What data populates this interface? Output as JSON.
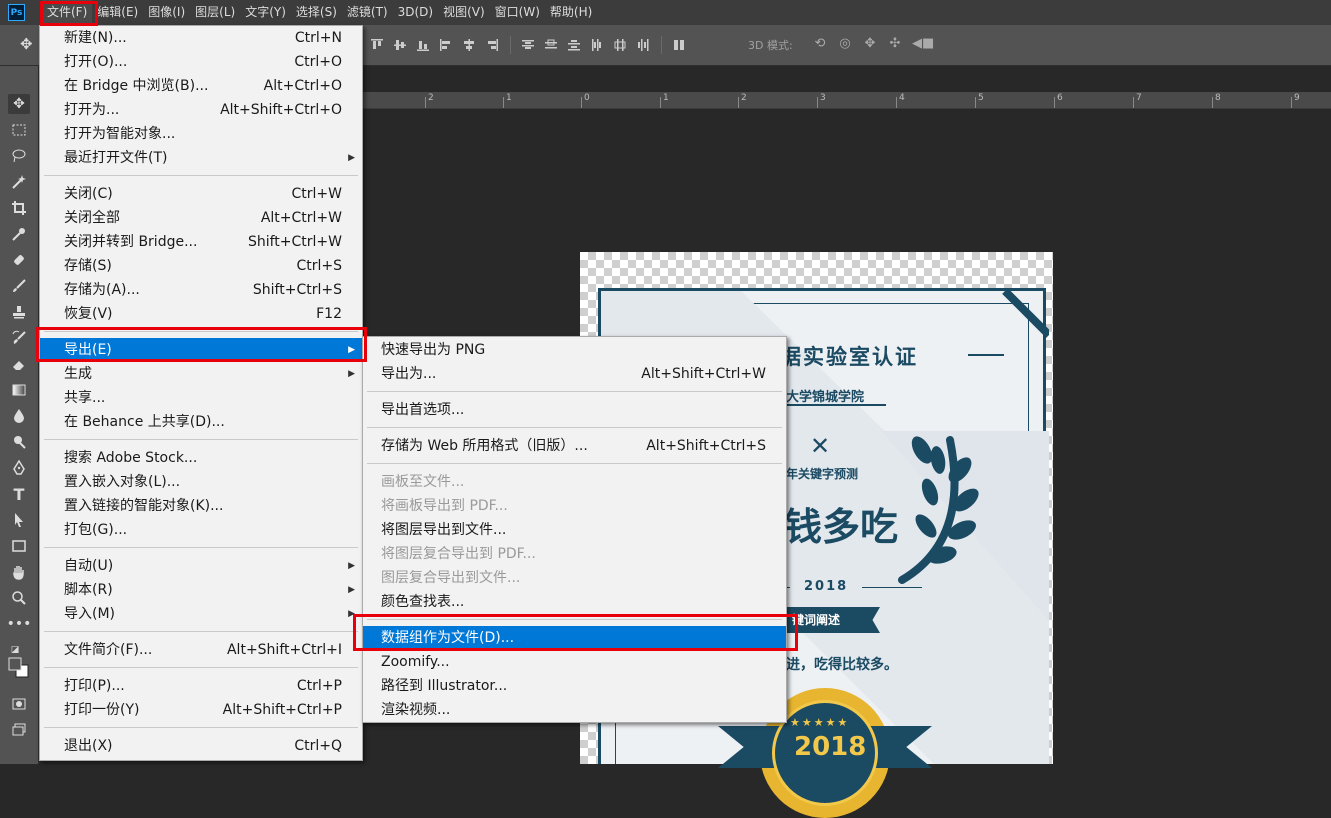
{
  "app": {
    "logo": "Ps"
  },
  "menubar": [
    {
      "id": "file",
      "label": "文件(F)",
      "active": true
    },
    {
      "id": "edit",
      "label": "编辑(E)"
    },
    {
      "id": "image",
      "label": "图像(I)"
    },
    {
      "id": "layer",
      "label": "图层(L)"
    },
    {
      "id": "type",
      "label": "文字(Y)"
    },
    {
      "id": "select",
      "label": "选择(S)"
    },
    {
      "id": "filter",
      "label": "滤镜(T)"
    },
    {
      "id": "3d",
      "label": "3D(D)"
    },
    {
      "id": "view",
      "label": "视图(V)"
    },
    {
      "id": "window",
      "label": "窗口(W)"
    },
    {
      "id": "help",
      "label": "帮助(H)"
    }
  ],
  "options_bar": {
    "mode_label": "3D 模式:"
  },
  "ruler": {
    "labels": [
      "2",
      "1",
      "0",
      "1",
      "2",
      "3",
      "4",
      "5",
      "6",
      "7",
      "8",
      "9"
    ]
  },
  "file_menu": {
    "items": [
      {
        "label": "新建(N)...",
        "shortcut": "Ctrl+N"
      },
      {
        "label": "打开(O)...",
        "shortcut": "Ctrl+O"
      },
      {
        "label": "在 Bridge 中浏览(B)...",
        "shortcut": "Alt+Ctrl+O"
      },
      {
        "label": "打开为...",
        "shortcut": "Alt+Shift+Ctrl+O"
      },
      {
        "label": "打开为智能对象...",
        "shortcut": ""
      },
      {
        "label": "最近打开文件(T)",
        "shortcut": "",
        "submenu": true
      },
      {
        "separator": true
      },
      {
        "label": "关闭(C)",
        "shortcut": "Ctrl+W"
      },
      {
        "label": "关闭全部",
        "shortcut": "Alt+Ctrl+W"
      },
      {
        "label": "关闭并转到 Bridge...",
        "shortcut": "Shift+Ctrl+W"
      },
      {
        "label": "存储(S)",
        "shortcut": "Ctrl+S"
      },
      {
        "label": "存储为(A)...",
        "shortcut": "Shift+Ctrl+S"
      },
      {
        "label": "恢复(V)",
        "shortcut": "F12"
      },
      {
        "separator": true
      },
      {
        "label": "导出(E)",
        "shortcut": "",
        "submenu": true,
        "highlighted": true
      },
      {
        "label": "生成",
        "shortcut": "",
        "submenu": true
      },
      {
        "label": "共享...",
        "shortcut": ""
      },
      {
        "label": "在 Behance 上共享(D)...",
        "shortcut": ""
      },
      {
        "separator": true
      },
      {
        "label": "搜索 Adobe Stock...",
        "shortcut": ""
      },
      {
        "label": "置入嵌入对象(L)...",
        "shortcut": ""
      },
      {
        "label": "置入链接的智能对象(K)...",
        "shortcut": ""
      },
      {
        "label": "打包(G)...",
        "shortcut": ""
      },
      {
        "separator": true
      },
      {
        "label": "自动(U)",
        "shortcut": "",
        "submenu": true
      },
      {
        "label": "脚本(R)",
        "shortcut": "",
        "submenu": true
      },
      {
        "label": "导入(M)",
        "shortcut": "",
        "submenu": true
      },
      {
        "separator": true
      },
      {
        "label": "文件简介(F)...",
        "shortcut": "Alt+Shift+Ctrl+I"
      },
      {
        "separator": true
      },
      {
        "label": "打印(P)...",
        "shortcut": "Ctrl+P"
      },
      {
        "label": "打印一份(Y)",
        "shortcut": "Alt+Shift+Ctrl+P"
      },
      {
        "separator": true
      },
      {
        "label": "退出(X)",
        "shortcut": "Ctrl+Q"
      }
    ]
  },
  "export_submenu": {
    "items": [
      {
        "label": "快速导出为 PNG",
        "shortcut": ""
      },
      {
        "label": "导出为...",
        "shortcut": "Alt+Shift+Ctrl+W"
      },
      {
        "separator": true
      },
      {
        "label": "导出首选项...",
        "shortcut": ""
      },
      {
        "separator": true
      },
      {
        "label": "存储为 Web 所用格式（旧版）...",
        "shortcut": "Alt+Shift+Ctrl+S"
      },
      {
        "separator": true
      },
      {
        "label": "画板至文件...",
        "shortcut": "",
        "disabled": true
      },
      {
        "label": "将画板导出到 PDF...",
        "shortcut": "",
        "disabled": true
      },
      {
        "label": "将图层导出到文件...",
        "shortcut": ""
      },
      {
        "label": "将图层复合导出到 PDF...",
        "shortcut": "",
        "disabled": true
      },
      {
        "label": "图层复合导出到文件...",
        "shortcut": "",
        "disabled": true
      },
      {
        "label": "颜色查找表...",
        "shortcut": ""
      },
      {
        "separator": true
      },
      {
        "label": "数据组作为文件(D)...",
        "shortcut": "",
        "highlighted": true
      },
      {
        "label": "Zoomify...",
        "shortcut": ""
      },
      {
        "label": "路径到 Illustrator...",
        "shortcut": ""
      },
      {
        "label": "渲染视频...",
        "shortcut": ""
      }
    ]
  },
  "certificate": {
    "title": "据实验室认证",
    "school": "大学锦城学院",
    "keyword_title": "年关键字预测",
    "keyword": "钱多吃",
    "year_small": "2018",
    "ribbon": "键词阐述",
    "description": "进，吃得比较多。",
    "medal_stars": "★★★★★",
    "medal_year": "2018"
  },
  "colors": {
    "highlight": "#0078d7",
    "annotation": "#e8000b",
    "cert_navy": "#1b4a63",
    "medal_gold": "#e7b530"
  }
}
